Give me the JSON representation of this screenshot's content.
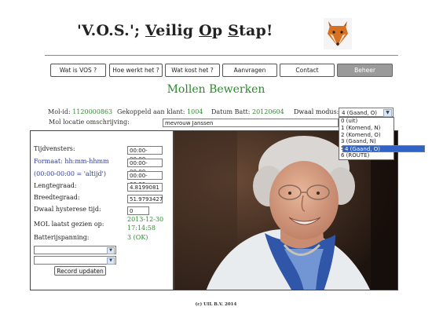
{
  "header": {
    "title_parts": [
      "'V.O.S.'; ",
      "V",
      "eilig ",
      "O",
      "p ",
      "S",
      "tap!"
    ],
    "logo_icon": "fox-icon"
  },
  "nav": {
    "items": [
      {
        "label": "Wat is VOS ?"
      },
      {
        "label": "Hoe werkt het ?"
      },
      {
        "label": "Wat kost het ?"
      },
      {
        "label": "Aanvragen"
      },
      {
        "label": "Contact"
      },
      {
        "label": "Beheer",
        "active": true
      }
    ]
  },
  "page_heading": "Mollen Bewerken",
  "info": {
    "mol_id_label": "Mol-id:",
    "mol_id_value": "1120000863",
    "linked_label": "Gekoppeld aan klant:",
    "linked_value": "1004",
    "batt_label": "Datum Batt:",
    "batt_value": "20120604",
    "mode_label": "Dwaal modus:",
    "mode_value": "4 (Gaand, O)",
    "mode_options": [
      "0 (uit)",
      "1 (Komend, N)",
      "2 (Komend, O)",
      "3 (Gaand, N)",
      "4 (Gaand, O)",
      "5 (SLAK)",
      "6 (ROUTE)"
    ],
    "mode_selected_index": 4,
    "location_label": "Mol locatie omschrijving:",
    "location_value": "mevrouw Janssen"
  },
  "form": {
    "windows_label": "Tijdvensters:",
    "format_label": "Formaat: hh:mm-hhmm",
    "always_label": "(00:00-00:00 = 'altijd')",
    "windows": [
      "00:00-00:00",
      "00:00-00:00",
      "00:00-00:00"
    ],
    "lat_label": "Lengtegraad:",
    "lat_value": "4.8199081",
    "lon_label": "Breedtegraad:",
    "lon_value": "51.9793427",
    "hyst_label": "Dwaal hysterese tijd:",
    "hyst_value": "0",
    "seen_label": "MOL laatst gezien op:",
    "seen_date": "2013-12-30",
    "seen_time": "17:14:58",
    "battery_label": "Batterijspanning:",
    "battery_value": "3 (OK)",
    "update_label": "Record updaten"
  },
  "footer": "(c) UIL B.V. 2014",
  "colors": {
    "green_text": "#2e8b2e",
    "blue_text": "#2a3a9a",
    "selection": "#3163c6"
  }
}
